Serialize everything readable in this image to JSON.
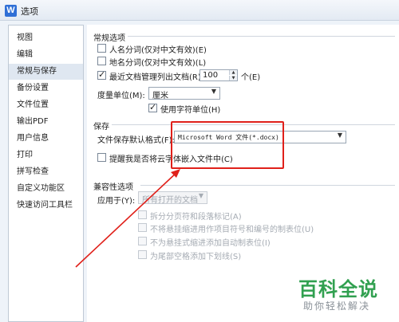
{
  "window": {
    "title": "选项",
    "icon": "wps-writer-icon"
  },
  "sidebar": {
    "items": [
      {
        "label": "视图",
        "active": false
      },
      {
        "label": "编辑",
        "active": false
      },
      {
        "label": "常规与保存",
        "active": true
      },
      {
        "label": "备份设置",
        "active": false
      },
      {
        "label": "文件位置",
        "active": false
      },
      {
        "label": "输出PDF",
        "active": false
      },
      {
        "label": "用户信息",
        "active": false
      },
      {
        "label": "打印",
        "active": false
      },
      {
        "label": "拼写检查",
        "active": false
      },
      {
        "label": "自定义功能区",
        "active": false
      },
      {
        "label": "快速访问工具栏",
        "active": false
      }
    ]
  },
  "general": {
    "title": "常规选项",
    "person_name": {
      "label": "人名分词(仅对中文有效)(E)",
      "checked": false
    },
    "place_name": {
      "label": "地名分词(仅对中文有效)(L)",
      "checked": false
    },
    "recent_docs": {
      "label": "最近文档管理列出文档(R):",
      "checked": true,
      "value": "100",
      "suffix": "个(E)"
    },
    "measure_unit": {
      "label": "度量单位(M):",
      "value": "厘米"
    },
    "use_char_unit": {
      "label": "使用字符单位(H)",
      "checked": true
    }
  },
  "save": {
    "title": "保存",
    "default_format": {
      "label": "文件保存默认格式(F):",
      "value": "Microsoft Word 文件(*.docx)"
    },
    "remind_fonts": {
      "label": "提醒我是否将云字体嵌入文件中(C)",
      "checked": false
    }
  },
  "compat": {
    "title": "兼容性选项",
    "apply_to": {
      "label": "应用于(Y):",
      "value": "所有打开的文档"
    },
    "options": [
      {
        "label": "拆分分页符和段落标记(A)",
        "checked": false
      },
      {
        "label": "不将悬挂缩进用作项目符号和编号的制表位(U)",
        "checked": false
      },
      {
        "label": "不为悬挂式缩进添加自动制表位(I)",
        "checked": false
      },
      {
        "label": "为尾部空格添加下划线(S)",
        "checked": false
      }
    ]
  },
  "colors": {
    "accent": "#2f6fd6",
    "highlight": "#e0201a",
    "watermark": "#31a050"
  },
  "watermark": {
    "title": "百科全说",
    "subtitle": "助你轻松解决"
  }
}
